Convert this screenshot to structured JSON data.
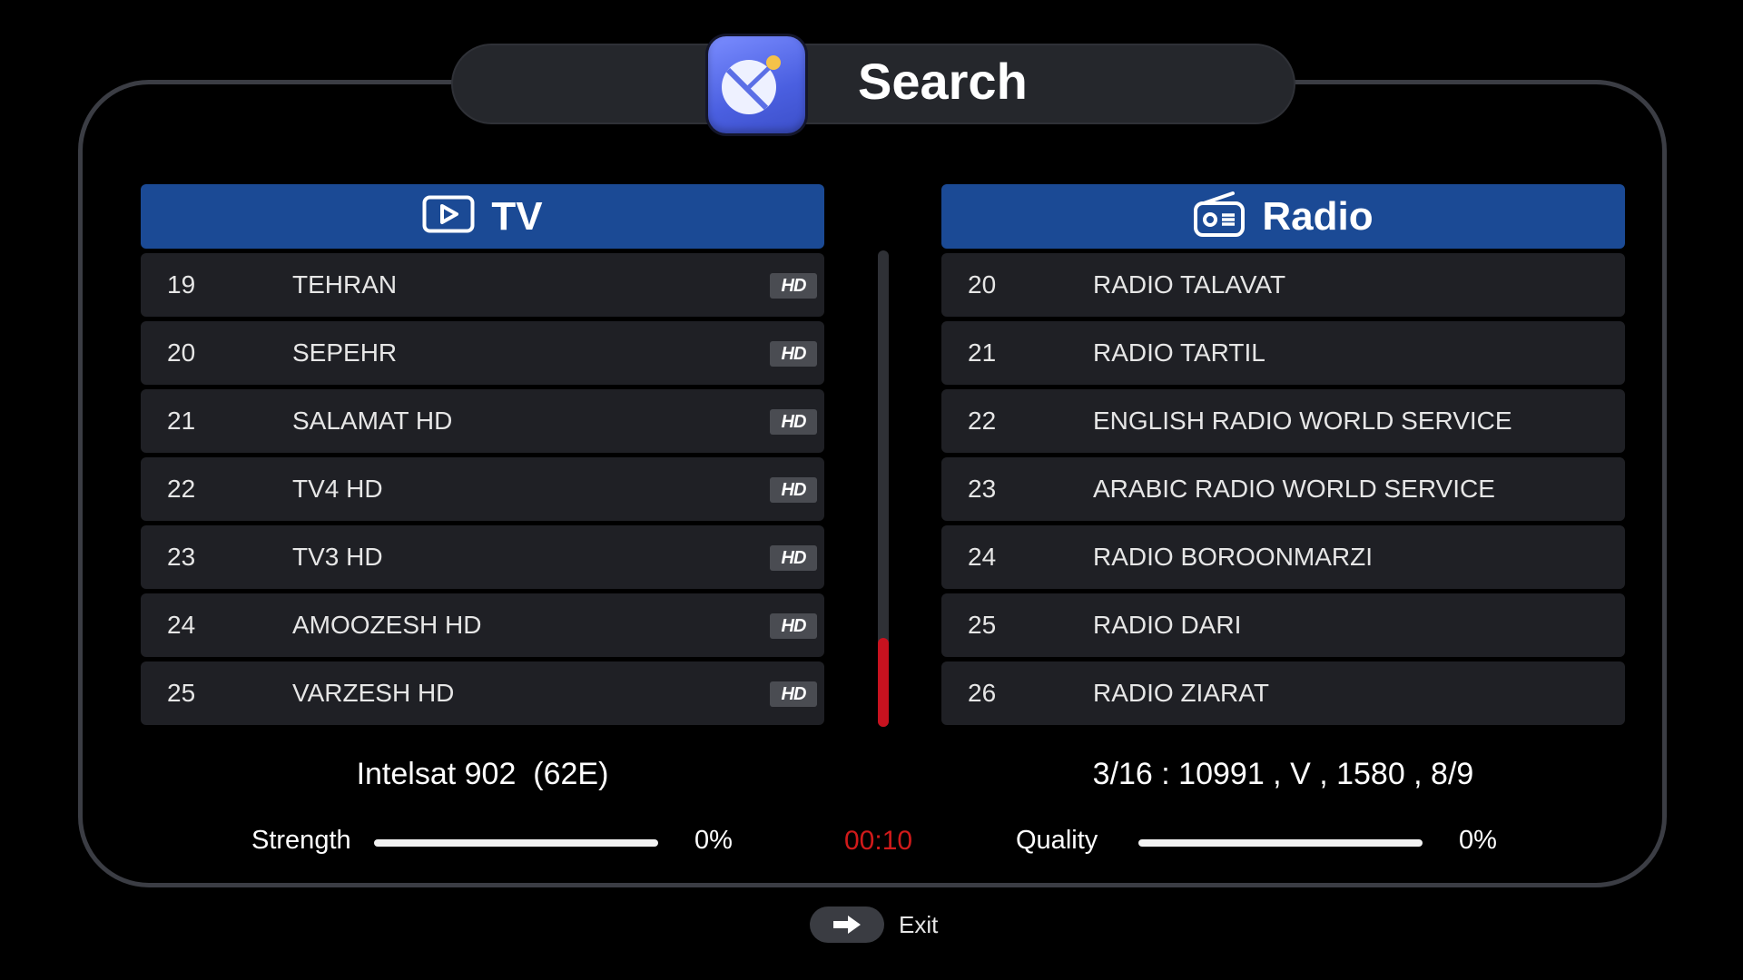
{
  "header": {
    "title": "Search",
    "icon": "satellite-dish-icon"
  },
  "tv": {
    "label": "TV",
    "icon": "play-screen-icon",
    "channels": [
      {
        "num": "19",
        "name": "TEHRAN",
        "badge": "HD"
      },
      {
        "num": "20",
        "name": "SEPEHR",
        "badge": "HD"
      },
      {
        "num": "21",
        "name": "SALAMAT HD",
        "badge": "HD"
      },
      {
        "num": "22",
        "name": "TV4 HD",
        "badge": "HD"
      },
      {
        "num": "23",
        "name": "TV3 HD",
        "badge": "HD"
      },
      {
        "num": "24",
        "name": "AMOOZESH HD",
        "badge": "HD"
      },
      {
        "num": "25",
        "name": "VARZESH HD",
        "badge": "HD"
      }
    ]
  },
  "radio": {
    "label": "Radio",
    "icon": "radio-icon",
    "channels": [
      {
        "num": "20",
        "name": "RADIO TALAVAT"
      },
      {
        "num": "21",
        "name": "RADIO TARTIL"
      },
      {
        "num": "22",
        "name": "ENGLISH RADIO WORLD SERVICE"
      },
      {
        "num": "23",
        "name": "ARABIC RADIO WORLD SERVICE"
      },
      {
        "num": "24",
        "name": "RADIO BOROONMARZI"
      },
      {
        "num": "25",
        "name": "RADIO DARI"
      },
      {
        "num": "26",
        "name": "RADIO ZIARAT"
      }
    ]
  },
  "status": {
    "satellite": "Intelsat 902  (62E)",
    "transponder": "3/16 : 10991 , V , 1580 , 8/9",
    "strength_label": "Strength",
    "strength_value": "0%",
    "quality_label": "Quality",
    "quality_value": "0%",
    "timer": "00:10"
  },
  "footer": {
    "exit_label": "Exit",
    "exit_icon": "exit-arrow-icon"
  },
  "colors": {
    "header_blue": "#1b4a95",
    "timer_red": "#d01a1a",
    "scroll_thumb": "#c8121f"
  }
}
